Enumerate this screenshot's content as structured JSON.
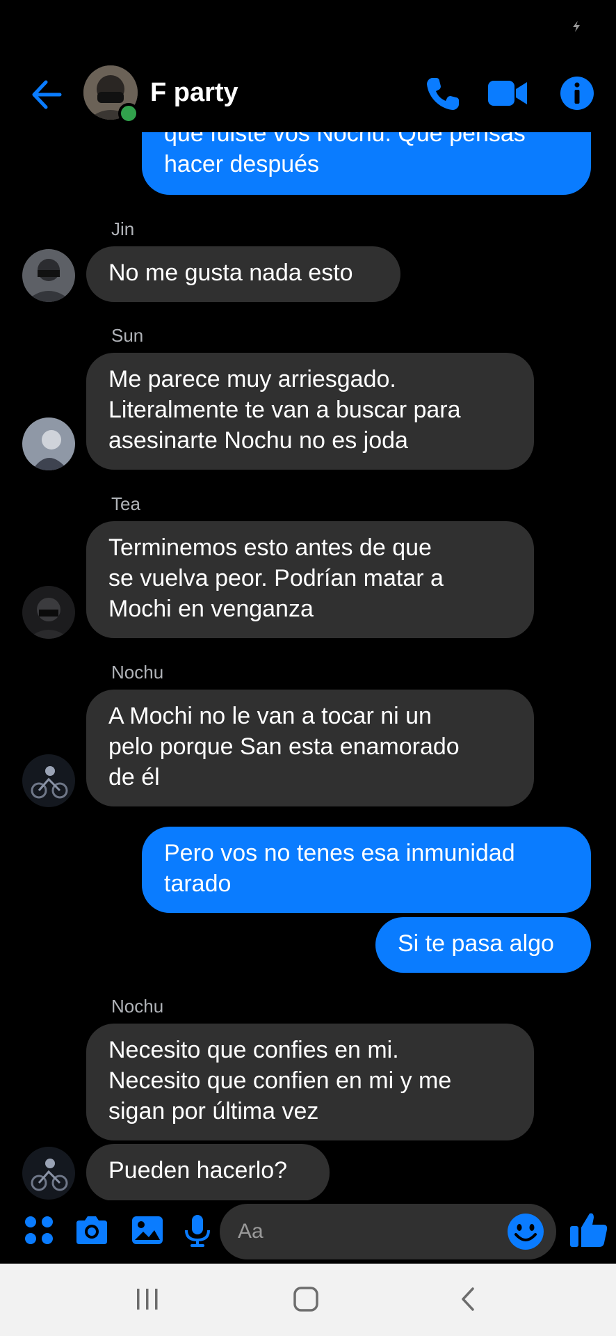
{
  "header": {
    "title": "F party"
  },
  "messages": [
    {
      "type": "out",
      "text": "que fuiste vos Nochu. Que pensas\nhacer después"
    },
    {
      "type": "in",
      "sender": "Jin",
      "text": "No me gusta nada esto"
    },
    {
      "type": "in",
      "sender": "Sun",
      "text": "Me parece muy arriesgado.\nLiteralmente te van a buscar para\nasesinarte Nochu no es joda"
    },
    {
      "type": "in",
      "sender": "Tea",
      "text": "Terminemos esto antes de que\nse vuelva  peor. Podrían matar a\nMochi en venganza"
    },
    {
      "type": "in",
      "sender": "Nochu",
      "text": "A Mochi no le van a tocar ni un\npelo porque San esta enamorado\nde él"
    },
    {
      "type": "out",
      "text": "Pero vos no tenes esa inmunidad\ntarado"
    },
    {
      "type": "out",
      "text": "Si te pasa algo"
    },
    {
      "type": "in",
      "sender": "Nochu",
      "text": "Necesito que confies en mi.\nNecesito que confien en mi y me\nsigan por última vez"
    },
    {
      "type": "in",
      "text": "Pueden hacerlo?"
    }
  ],
  "composer": {
    "placeholder": "Aa"
  },
  "colors": {
    "accent": "#0a7cff",
    "bubble_in": "#303030",
    "background": "#000000",
    "online": "#31a24c"
  },
  "icons": {
    "header": [
      "back-arrow-icon",
      "phone-icon",
      "video-camera-icon",
      "info-icon"
    ],
    "composer": [
      "apps-icon",
      "camera-icon",
      "gallery-icon",
      "microphone-icon",
      "emoji-icon",
      "thumbs-up-icon"
    ],
    "navigation": [
      "recents-icon",
      "home-icon",
      "back-icon"
    ]
  }
}
